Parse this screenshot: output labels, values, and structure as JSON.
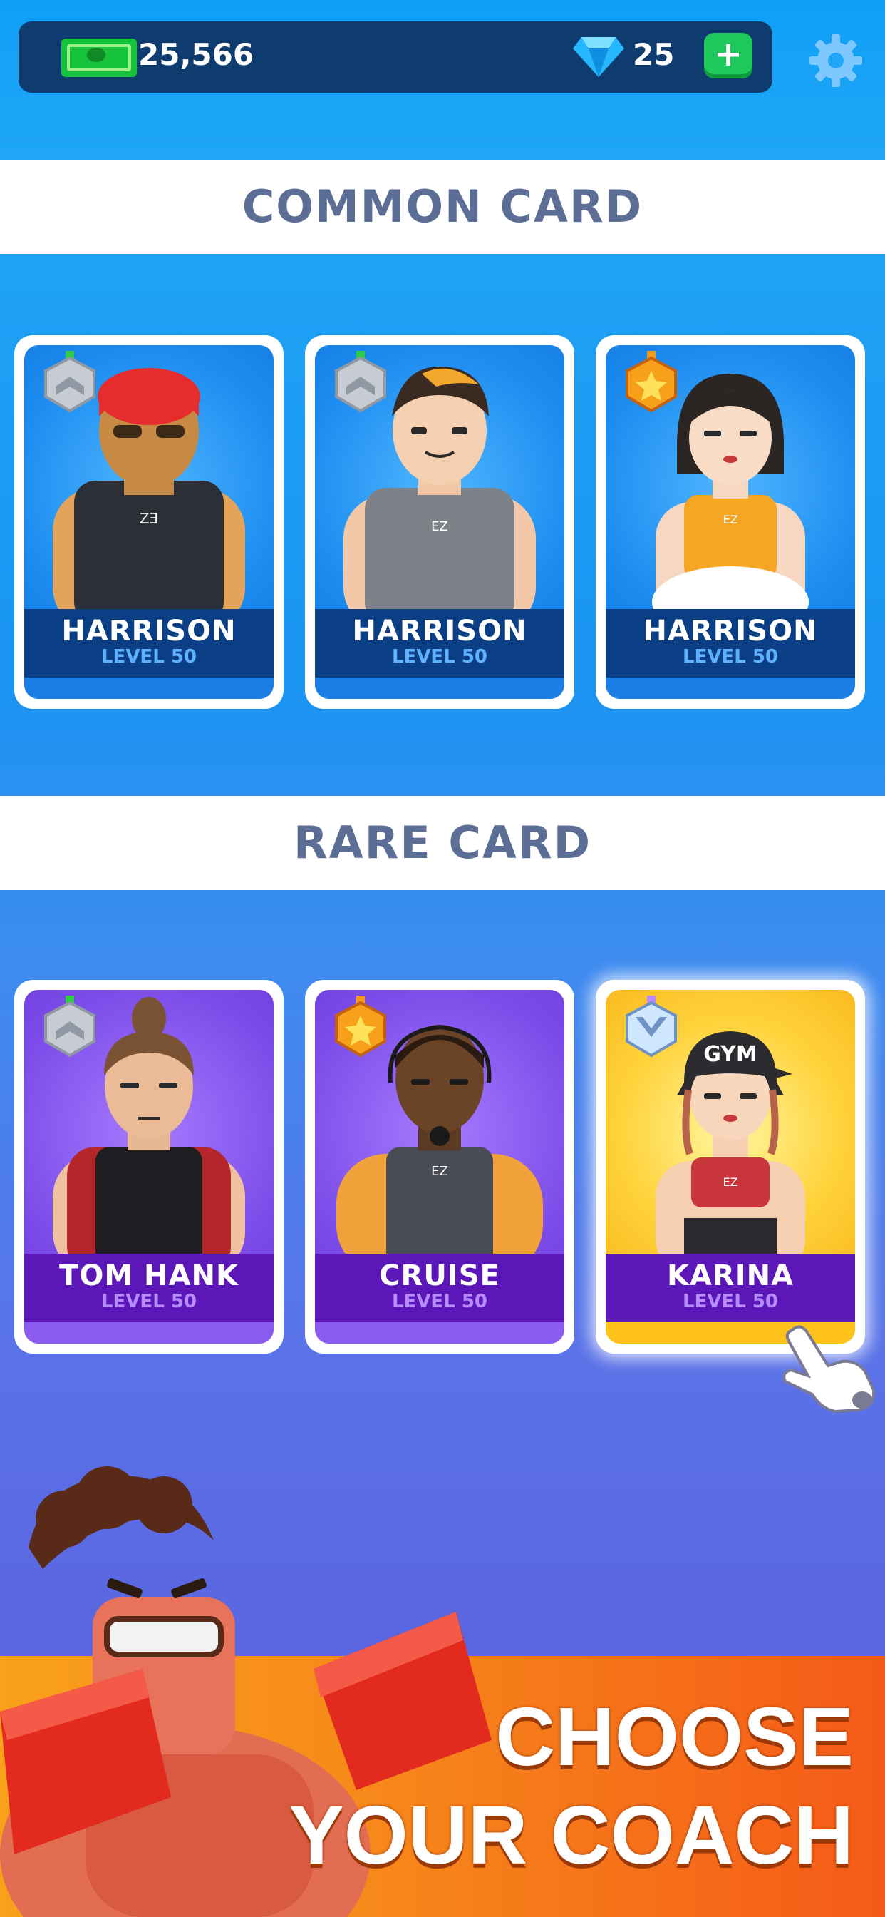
{
  "topbar": {
    "cash_value": "25,566",
    "gem_value": "25",
    "plus_label": "+",
    "icons": [
      "cash-icon",
      "gem-icon",
      "plus-icon",
      "gear-icon"
    ]
  },
  "sections": {
    "common_title": "COMMON CARD",
    "rare_title": "RARE CARD"
  },
  "common_cards": [
    {
      "name": "HARRISON",
      "level": "LEVEL 50",
      "rank_badge": "silver"
    },
    {
      "name": "HARRISON",
      "level": "LEVEL 50",
      "rank_badge": "silver"
    },
    {
      "name": "HARRISON",
      "level": "LEVEL 50",
      "rank_badge": "gold"
    }
  ],
  "rare_cards": [
    {
      "name": "TOM HANK",
      "level": "LEVEL 50",
      "rank_badge": "silver"
    },
    {
      "name": "CRUISE",
      "level": "LEVEL 50",
      "rank_badge": "gold"
    },
    {
      "name": "KARINA",
      "level": "LEVEL 50",
      "rank_badge": "platinum"
    }
  ],
  "banner": {
    "line1": "CHOOSE",
    "line2": "YOUR COACH"
  },
  "colors": {
    "topbar": "#0e3c6e",
    "header_text": "#5d6e96",
    "common_plate": "#0a3f86",
    "rare_plate": "#5b17b8",
    "banner": "#f78a1a"
  }
}
